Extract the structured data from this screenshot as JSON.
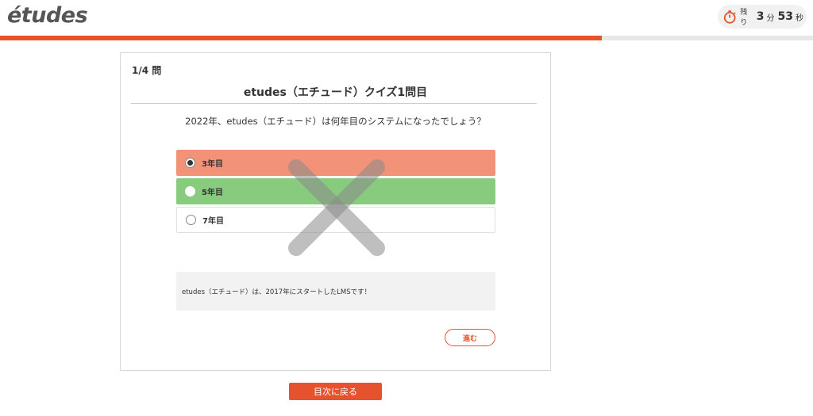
{
  "header": {
    "logo": "étude s",
    "logo_text": "étude s",
    "timer": {
      "label": "残り",
      "minutes": "3",
      "minutes_unit": "分",
      "seconds": "53",
      "seconds_unit": "秒"
    }
  },
  "progress": {
    "fraction": 0.74
  },
  "quiz": {
    "counter": "1/4 問",
    "title": "etudes（エチュード）クイズ1問目",
    "question": "2022年、etudes（エチュード）は何年目のシステムになったでしょう？",
    "choices": [
      {
        "label": "3年目",
        "state": "selected-wrong"
      },
      {
        "label": "5年目",
        "state": "correct"
      },
      {
        "label": "7年目",
        "state": "neutral"
      }
    ],
    "explanation": "etudes（エチュード）は、2017年にスタートしたLMSです！",
    "next_label": "進む"
  },
  "footer": {
    "back_label": "目次に戻る"
  },
  "colors": {
    "accent": "#e4532e",
    "wrong": "#f29278",
    "correct": "#88cb7f"
  }
}
